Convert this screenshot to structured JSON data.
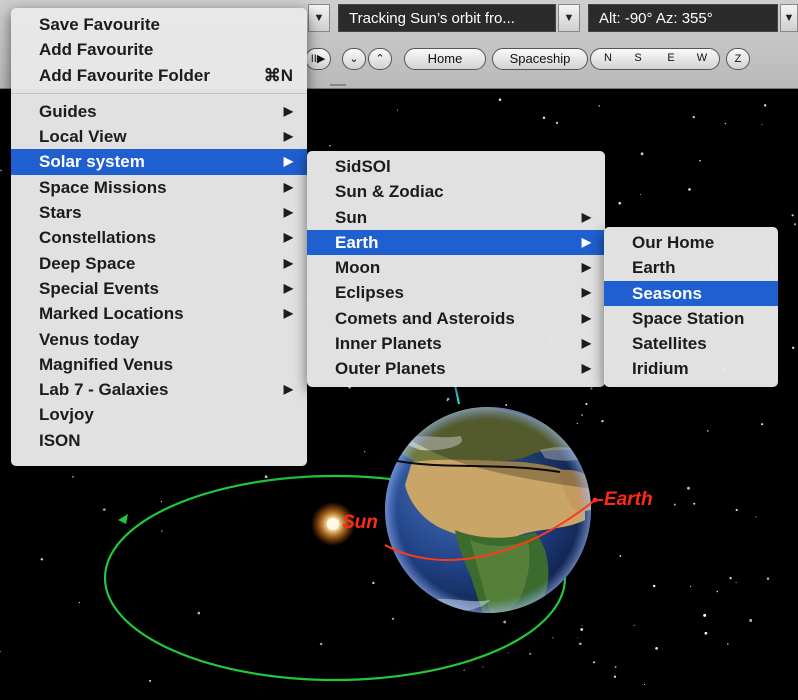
{
  "toolbar": {
    "tracking_field": "Tracking Sun’s orbit fro...",
    "altaz_field": "Alt: -90° Az: 355°",
    "play_label": "II▶",
    "down_label": "⌄",
    "up_label": "⌃",
    "home_label": "Home",
    "spaceship_label": "Spaceship",
    "n_label": "N",
    "s_label": "S",
    "e_label": "E",
    "w_label": "W",
    "z_label": "Z"
  },
  "menu1": {
    "top_items": [
      {
        "label": "Save Favourite"
      },
      {
        "label": "Add Favourite"
      },
      {
        "label": "Add Favourite Folder",
        "shortcut": "⌘N"
      }
    ],
    "items": [
      {
        "label": "Guides",
        "submenu": true
      },
      {
        "label": "Local View",
        "submenu": true
      },
      {
        "label": "Solar system",
        "submenu": true,
        "highlighted": true
      },
      {
        "label": "Space Missions",
        "submenu": true
      },
      {
        "label": "Stars",
        "submenu": true
      },
      {
        "label": "Constellations",
        "submenu": true
      },
      {
        "label": "Deep Space",
        "submenu": true
      },
      {
        "label": "Special Events",
        "submenu": true
      },
      {
        "label": "Marked Locations",
        "submenu": true
      },
      {
        "label": "Venus today",
        "submenu": false
      },
      {
        "label": "Magnified Venus",
        "submenu": false
      },
      {
        "label": "Lab 7 - Galaxies",
        "submenu": true
      },
      {
        "label": "Lovjoy",
        "submenu": false
      },
      {
        "label": "ISON",
        "submenu": false
      }
    ]
  },
  "menu2": {
    "items": [
      {
        "label": "SidSOl",
        "submenu": false
      },
      {
        "label": "Sun & Zodiac",
        "submenu": false
      },
      {
        "label": "Sun",
        "submenu": true
      },
      {
        "label": "Earth",
        "submenu": true,
        "highlighted": true
      },
      {
        "label": "Moon",
        "submenu": true
      },
      {
        "label": "Eclipses",
        "submenu": true
      },
      {
        "label": "Comets and Asteroids",
        "submenu": true
      },
      {
        "label": "Inner Planets",
        "submenu": true
      },
      {
        "label": "Outer Planets",
        "submenu": true
      }
    ]
  },
  "menu3": {
    "items": [
      {
        "label": "Our Home"
      },
      {
        "label": "Earth"
      },
      {
        "label": "Seasons",
        "highlighted": true
      },
      {
        "label": "Space Station"
      },
      {
        "label": "Satellites"
      },
      {
        "label": "Iridium"
      }
    ]
  },
  "scene": {
    "sun_label": "Sun",
    "earth_label": "Earth",
    "orbit_color": "#22c83a",
    "label_color": "#ff2a1a",
    "highlight_color": "#1f5fcf"
  },
  "icons": {
    "submenu_arrow": "▶",
    "dropdown_arrow": "▼"
  }
}
